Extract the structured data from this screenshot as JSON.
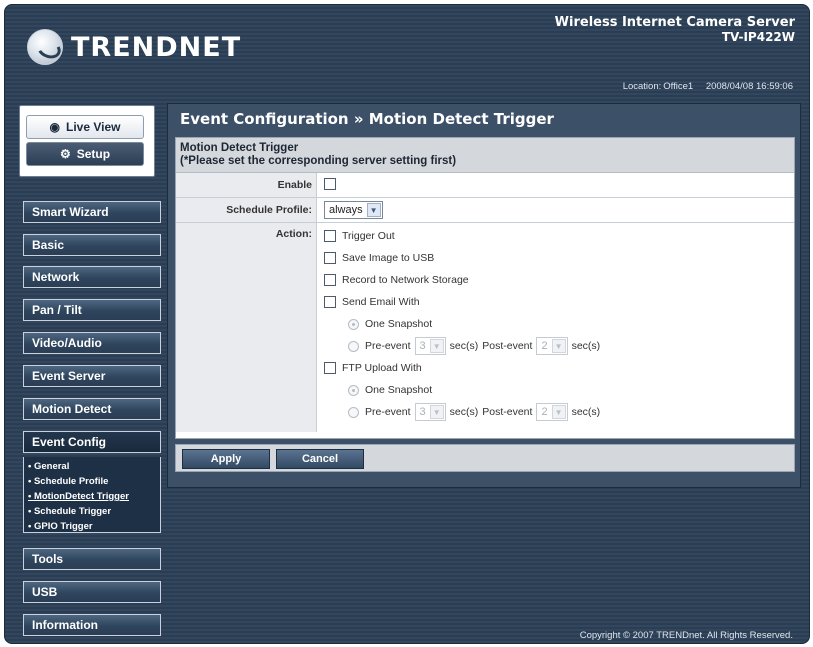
{
  "header": {
    "brand": "TRENDNET",
    "product_line": "Wireless Internet Camera Server",
    "model": "TV-IP422W",
    "location_label": "Location:",
    "location_value": "Office1",
    "datetime": "2008/04/08 16:59:06"
  },
  "mode_buttons": {
    "live_view": "Live View",
    "setup": "Setup"
  },
  "nav": {
    "items": [
      {
        "label": "Smart Wizard"
      },
      {
        "label": "Basic"
      },
      {
        "label": "Network"
      },
      {
        "label": "Pan / Tilt"
      },
      {
        "label": "Video/Audio"
      },
      {
        "label": "Event Server"
      },
      {
        "label": "Motion Detect"
      },
      {
        "label": "Event Config"
      },
      {
        "label": "Tools"
      },
      {
        "label": "USB"
      },
      {
        "label": "Information"
      }
    ],
    "sub_items": [
      {
        "label": "• General"
      },
      {
        "label": "• Schedule Profile"
      },
      {
        "label": "• MotionDetect Trigger"
      },
      {
        "label": "• Schedule Trigger"
      },
      {
        "label": "• GPIO Trigger"
      }
    ],
    "active": "Event Config",
    "active_sub": "MotionDetect Trigger"
  },
  "main": {
    "title": "Event Configuration » Motion Detect Trigger",
    "section_title": "Motion Detect Trigger",
    "section_note": "(*Please set the corresponding server setting first)",
    "enable_label": "Enable",
    "enable_checked": false,
    "schedule_label": "Schedule Profile:",
    "schedule_value": "always",
    "action_label": "Action:",
    "actions": {
      "trigger_out": "Trigger Out",
      "save_usb": "Save Image to USB",
      "record_nas": "Record to Network Storage",
      "send_email": "Send Email With",
      "ftp_upload": "FTP Upload With"
    },
    "email": {
      "one_snapshot": "One Snapshot",
      "pre_event": "Pre-event",
      "pre_value": "3",
      "sec1": "sec(s)",
      "post_event": "Post-event",
      "post_value": "2",
      "sec2": "sec(s)"
    },
    "ftp": {
      "one_snapshot": "One Snapshot",
      "pre_event": "Pre-event",
      "pre_value": "3",
      "sec1": "sec(s)",
      "post_event": "Post-event",
      "post_value": "2",
      "sec2": "sec(s)"
    },
    "apply_label": "Apply",
    "cancel_label": "Cancel"
  },
  "footer": {
    "copyright": "Copyright © 2007 TRENDnet. All Rights Reserved."
  },
  "icons": {
    "live_view": "eye-icon",
    "setup": "gears-icon",
    "dropdown": "chevron-down-icon"
  }
}
